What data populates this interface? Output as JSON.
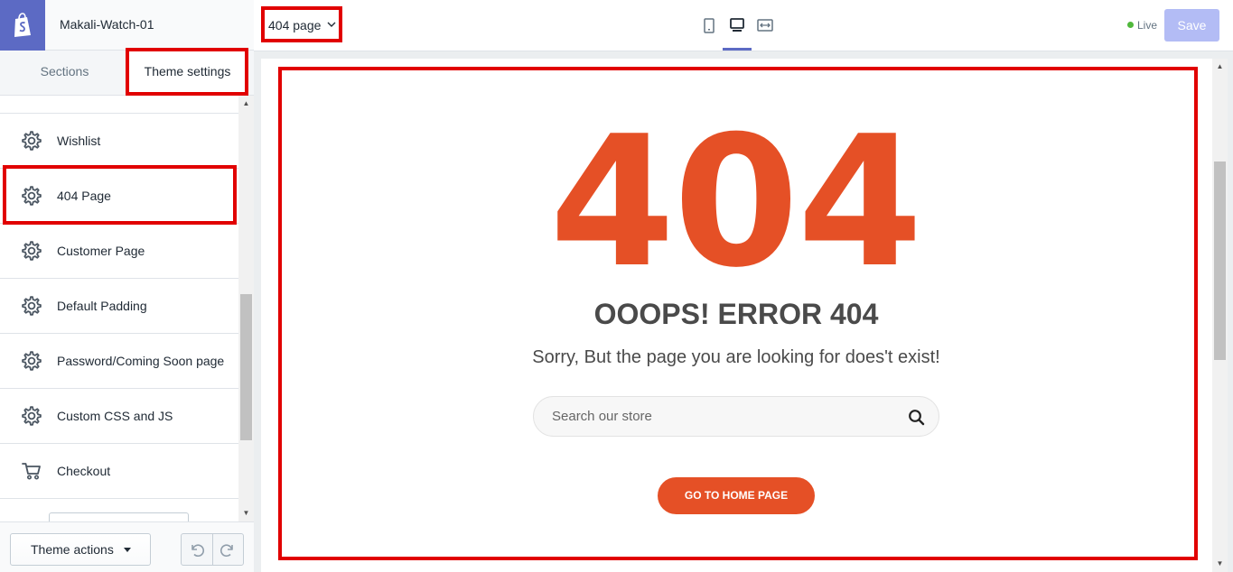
{
  "sidebar": {
    "store_name": "Makali-Watch-01",
    "tabs": [
      {
        "label": "Sections"
      },
      {
        "label": "Theme settings"
      }
    ],
    "items": [
      {
        "label": "Wishlist",
        "icon": "gear-icon"
      },
      {
        "label": "404 Page",
        "icon": "gear-icon"
      },
      {
        "label": "Customer Page",
        "icon": "gear-icon"
      },
      {
        "label": "Default Padding",
        "icon": "gear-icon"
      },
      {
        "label": "Password/Coming Soon page",
        "icon": "gear-icon"
      },
      {
        "label": "Custom CSS and JS",
        "icon": "gear-icon"
      },
      {
        "label": "Checkout",
        "icon": "cart-icon"
      }
    ],
    "theme_actions_label": "Theme actions"
  },
  "topbar": {
    "page_select_value": "404 page",
    "live_label": "Live",
    "save_label": "Save"
  },
  "preview": {
    "big_code": "404",
    "title": "OOOPS! ERROR 404",
    "message": "Sorry, But the page you are looking for does't exist!",
    "search_placeholder": "Search our store",
    "home_button": "GO TO HOME PAGE"
  },
  "colors": {
    "accent": "#5c6ac4",
    "error_orange": "#e55026",
    "highlight_red": "#e10000",
    "save_disabled": "#b3bcf5",
    "live_green": "#50b83c"
  }
}
